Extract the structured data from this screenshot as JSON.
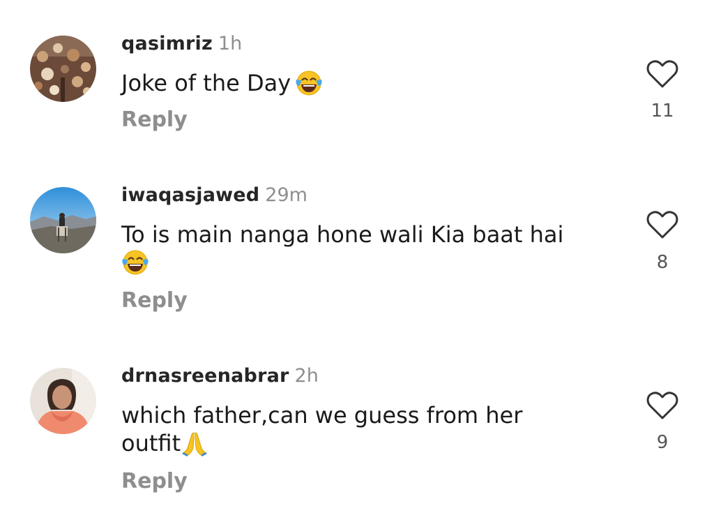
{
  "comments": [
    {
      "username": "qasimriz",
      "time": "1h",
      "text": "Joke of the Day",
      "emoji": "face-with-tears-of-joy-icon",
      "reply_label": "Reply",
      "likes": "11",
      "like_icon": "heart-outline-icon"
    },
    {
      "username": "iwaqasjawed",
      "time": "29m",
      "text": "To is main nanga hone wali Kia baat hai",
      "emoji": "face-with-tears-of-joy-icon",
      "reply_label": "Reply",
      "likes": "8",
      "like_icon": "heart-outline-icon"
    },
    {
      "username": "drnasreenabrar",
      "time": "2h",
      "text": "which father,can we guess from her outfit",
      "emoji": "folded-hands-icon",
      "reply_label": "Reply",
      "likes": "9",
      "like_icon": "heart-outline-icon"
    }
  ],
  "colors": {
    "username": "#262626",
    "secondary": "#8e8e8e",
    "text": "#1a1a1a",
    "emoji_yellow": "#f7c325"
  }
}
